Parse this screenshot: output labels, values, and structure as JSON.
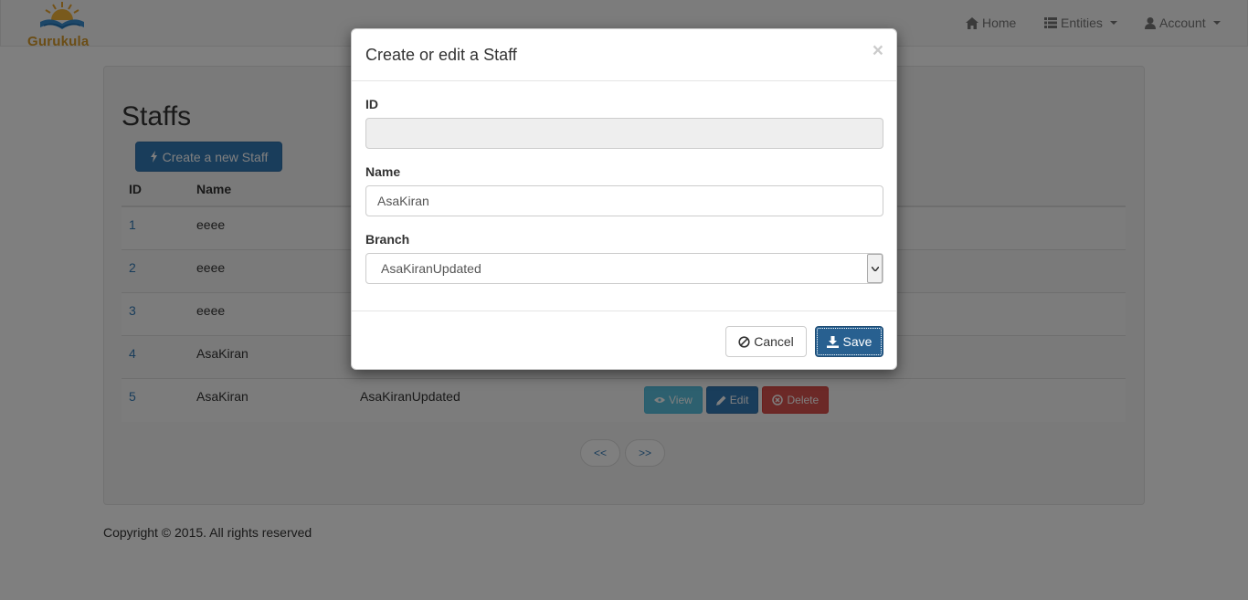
{
  "brand": {
    "name": "Gurukula"
  },
  "nav": {
    "home": "Home",
    "entities": "Entities",
    "account": "Account"
  },
  "page": {
    "title": "Staffs",
    "create_button": "Create a new Staff"
  },
  "table": {
    "headers": {
      "id": "ID",
      "name": "Name"
    },
    "rows": [
      {
        "id": "1",
        "name": "eeee",
        "branch": ""
      },
      {
        "id": "2",
        "name": "eeee",
        "branch": ""
      },
      {
        "id": "3",
        "name": "eeee",
        "branch": ""
      },
      {
        "id": "4",
        "name": "AsaKiran",
        "branch": ""
      },
      {
        "id": "5",
        "name": "AsaKiran",
        "branch": "AsaKiranUpdated"
      }
    ],
    "actions": {
      "view": "View",
      "edit": "Edit",
      "delete": "Delete"
    }
  },
  "pager": {
    "prev": "<<",
    "next": ">>"
  },
  "footer": {
    "text": "Copyright © 2015. All rights reserved"
  },
  "modal": {
    "title": "Create or edit a Staff",
    "close": "×",
    "fields": {
      "id_label": "ID",
      "id_value": "",
      "name_label": "Name",
      "name_value": "AsaKiran",
      "branch_label": "Branch",
      "branch_value": "AsaKiranUpdated"
    },
    "cancel": "Cancel",
    "save": "Save"
  },
  "colors": {
    "primary": "#337ab7",
    "info": "#5bc0de",
    "danger": "#d9534f",
    "brand": "#d79a2b"
  }
}
